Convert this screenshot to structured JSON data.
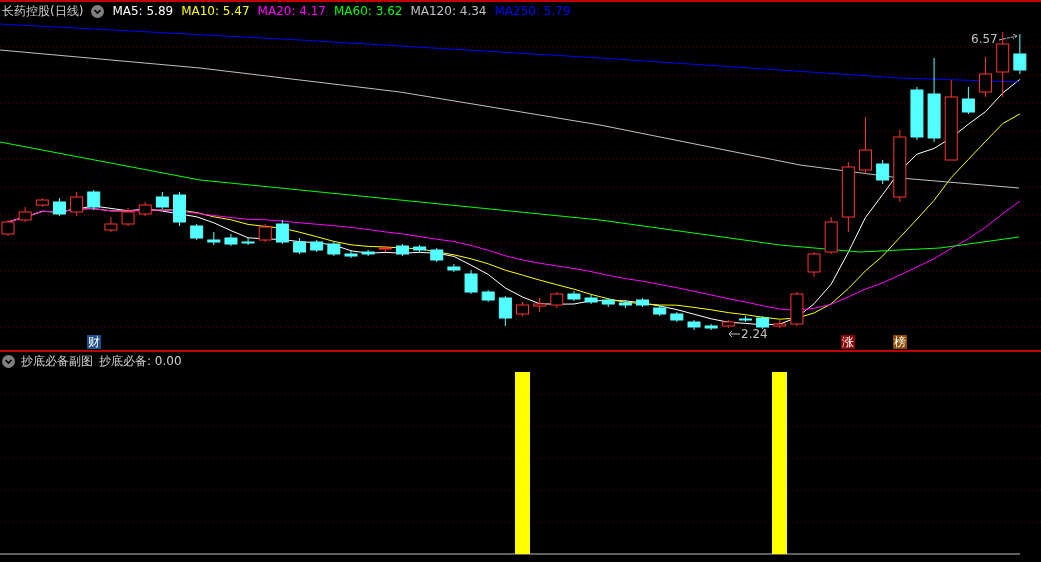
{
  "header": {
    "title": "长药控股(日线)",
    "indicators": [
      {
        "label": "MA5: 5.89",
        "color": "#ffffff"
      },
      {
        "label": "MA10: 5.47",
        "color": "#ffff00"
      },
      {
        "label": "MA20: 4.17",
        "color": "#ff00ff"
      },
      {
        "label": "MA60: 3.62",
        "color": "#00ff00"
      },
      {
        "label": "MA120: 4.34",
        "color": "#c0c0c0"
      },
      {
        "label": "MA250: 5.79",
        "color": "#0000ff"
      }
    ]
  },
  "main_chart": {
    "high_label": "6.57",
    "low_label": "2.24",
    "markers": [
      {
        "text": "财",
        "color": "#1f4e8c"
      },
      {
        "text": "涨",
        "color": "#8b0000"
      },
      {
        "text": "榜",
        "color": "#8b4a00"
      }
    ]
  },
  "sub_panel": {
    "title": "抄底必备副图",
    "indicator": "抄底必备: 0.00"
  }
}
